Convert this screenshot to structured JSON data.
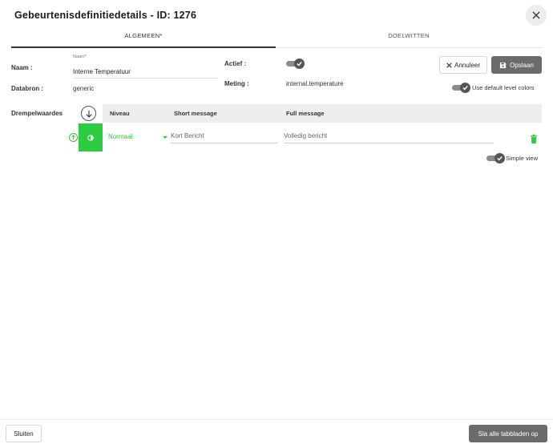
{
  "dialog": {
    "title": "Gebeurtenisdefinitiedetails - ID: 1276",
    "close_icon": "close-icon"
  },
  "tabs": [
    {
      "label": "ALGEMEEN*",
      "active": true
    },
    {
      "label": "DOELWITTEN",
      "active": false
    }
  ],
  "form": {
    "name_label": "Naam :",
    "name_float_label": "Naam*",
    "name_value": "Interne Temperatuur",
    "datasource_label": "Databron :",
    "datasource_value": "generic",
    "active_label": "Actief :",
    "active_on": true,
    "metric_label": "Meting :",
    "metric_value": "internal.temperature",
    "default_colors_label": "Use default level colors",
    "default_colors_on": true
  },
  "actions": {
    "cancel_label": "Annuleer",
    "save_label": "Opslaan"
  },
  "thresholds": {
    "section_label": "Drempelwaardes",
    "columns": [
      "Niveau",
      "Short message",
      "Full message"
    ],
    "rows": [
      {
        "level": "Normaal",
        "color": "#2ecc40",
        "short_placeholder": "Kort Bericht",
        "full_placeholder": "Volledig bericht"
      }
    ],
    "simple_view_label": "Simple view",
    "simple_view_on": true
  },
  "footer": {
    "close_label": "Sluiten",
    "save_all_label": "Sla alle tabbladen op"
  },
  "colors": {
    "accent_green": "#2ecc40",
    "button_grey": "#6b6b6b"
  }
}
